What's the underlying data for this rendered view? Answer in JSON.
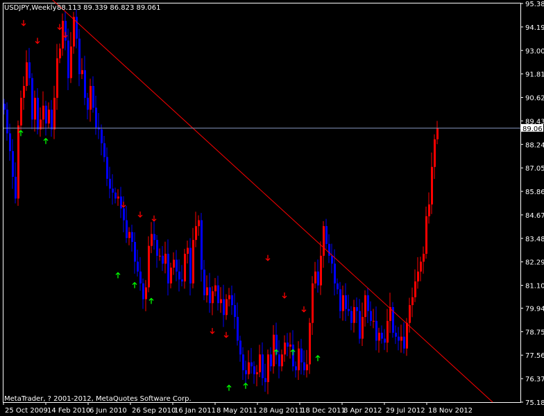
{
  "header": {
    "symbol": "USDJPY,Weekly",
    "ohlc": "88.113 89.339 86.823 89.061"
  },
  "footer": {
    "copyright": "MetaTrader, ? 2001-2012, MetaQuotes Software Corp."
  },
  "colors": {
    "background": "#000000",
    "frame": "#ffffff",
    "bull": "#ff0000",
    "bear": "#0000ff",
    "trendline": "#ff0000",
    "bid_line": "#8c9cc4",
    "up_arrow": "#00ff00",
    "down_arrow": "#ff0000"
  },
  "chart_data": {
    "type": "candlestick",
    "title": "USDJPY,Weekly",
    "last_price": "89.061",
    "ylim": [
      75.185,
      95.38
    ],
    "y_ticks": [
      "95.380",
      "94.190",
      "93.000",
      "91.810",
      "90.620",
      "89.430",
      "88.240",
      "87.050",
      "85.860",
      "84.670",
      "83.480",
      "82.290",
      "81.100",
      "79.945",
      "78.755",
      "77.565",
      "76.375",
      "75.185"
    ],
    "x_ticks": [
      "25 Oct 2009",
      "14 Feb 2010",
      "6 Jun 2010",
      "26 Sep 2010",
      "16 Jan 2011",
      "8 May 2011",
      "28 Aug 2011",
      "18 Dec 2011",
      "8 Apr 2012",
      "29 Jul 2012",
      "18 Nov 2012"
    ],
    "closes": [
      90.0,
      88.8,
      87.9,
      86.6,
      85.5,
      89.2,
      90.6,
      91.2,
      92.4,
      91.6,
      89.5,
      90.6,
      89.0,
      89.5,
      90.2,
      89.3,
      90.0,
      89.0,
      90.6,
      92.6,
      93.1,
      94.5,
      93.5,
      91.6,
      93.2,
      94.7,
      93.6,
      91.8,
      92.0,
      90.6,
      90.0,
      91.2,
      90.1,
      89.1,
      89.0,
      88.3,
      87.6,
      86.5,
      86.0,
      85.8,
      85.5,
      85.6,
      85.0,
      84.4,
      83.5,
      83.8,
      83.3,
      82.3,
      81.8,
      81.2,
      80.4,
      81.0,
      83.1,
      83.7,
      83.4,
      82.6,
      82.6,
      82.2,
      82.7,
      81.2,
      82.0,
      82.4,
      81.8,
      81.4,
      81.3,
      82.7,
      83.0,
      81.2,
      83.4,
      84.1,
      84.4,
      81.9,
      80.6,
      81.0,
      80.2,
      80.8,
      81.1,
      80.2,
      80.4,
      79.6,
      80.4,
      80.6,
      80.1,
      79.5,
      78.3,
      77.6,
      76.8,
      76.6,
      77.2,
      77.0,
      76.6,
      76.7,
      77.6,
      76.4,
      76.2,
      77.6,
      77.0,
      78.6,
      77.6,
      77.0,
      77.6,
      78.2,
      78.0,
      78.1,
      77.0,
      76.8,
      77.9,
      77.2,
      76.8,
      77.1,
      79.2,
      81.2,
      81.8,
      81.1,
      82.6,
      84.1,
      83.2,
      82.6,
      82.2,
      81.2,
      80.9,
      79.8,
      80.6,
      79.9,
      79.8,
      79.2,
      80.0,
      79.8,
      78.4,
      79.5,
      80.6,
      79.8,
      79.3,
      79.3,
      78.3,
      78.7,
      78.4,
      78.2,
      79.3,
      80.0,
      78.7,
      78.5,
      78.3,
      78.5,
      77.9,
      79.2,
      80.1,
      80.5,
      81.3,
      81.8,
      82.3,
      82.7,
      84.6,
      85.2,
      87.1,
      88.5,
      89.061
    ],
    "trendline": {
      "from_index": 0,
      "from_price": 97.8,
      "to_index": 176,
      "to_price": 75.185
    }
  },
  "arrows": {
    "down": [
      [
        7,
        94.4
      ],
      [
        12,
        93.5
      ],
      [
        20,
        94.2
      ],
      [
        22,
        93.8
      ],
      [
        43,
        85.2
      ],
      [
        49,
        84.7
      ],
      [
        54,
        84.5
      ],
      [
        75,
        78.8
      ],
      [
        80,
        78.6
      ],
      [
        95,
        82.5
      ],
      [
        101,
        80.6
      ],
      [
        108,
        79.9
      ]
    ],
    "up": [
      [
        6,
        88.8
      ],
      [
        15,
        88.4
      ],
      [
        41,
        81.6
      ],
      [
        47,
        81.1
      ],
      [
        53,
        80.3
      ],
      [
        81,
        75.9
      ],
      [
        87,
        76.0
      ],
      [
        98,
        77.7
      ],
      [
        104,
        77.7
      ],
      [
        113,
        77.4
      ]
    ]
  }
}
